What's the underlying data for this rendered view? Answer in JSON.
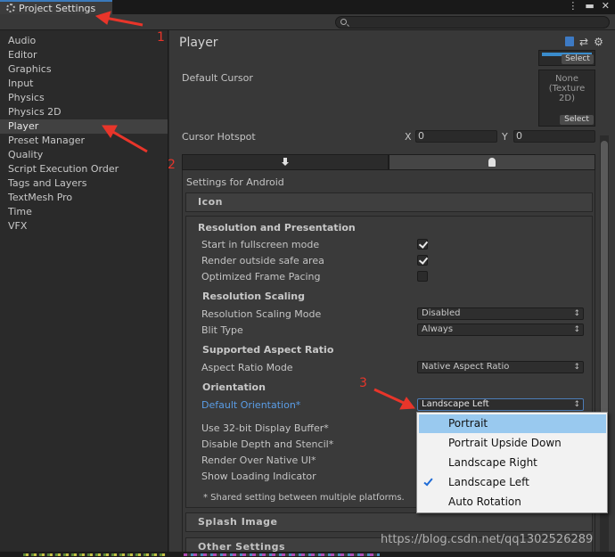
{
  "window": {
    "title": "Project Settings"
  },
  "sidebar": {
    "items": [
      {
        "label": "Audio"
      },
      {
        "label": "Editor"
      },
      {
        "label": "Graphics"
      },
      {
        "label": "Input"
      },
      {
        "label": "Physics"
      },
      {
        "label": "Physics 2D"
      },
      {
        "label": "Player"
      },
      {
        "label": "Preset Manager"
      },
      {
        "label": "Quality"
      },
      {
        "label": "Script Execution Order"
      },
      {
        "label": "Tags and Layers"
      },
      {
        "label": "TextMesh Pro"
      },
      {
        "label": "Time"
      },
      {
        "label": "VFX"
      }
    ],
    "selected": "Player"
  },
  "main": {
    "title": "Player",
    "default_cursor": {
      "label": "Default Cursor",
      "value_line1": "None",
      "value_line2": "(Texture",
      "value_line3": "2D)",
      "select": "Select"
    },
    "top_select": "Select",
    "cursor_hotspot": {
      "label": "Cursor Hotspot",
      "x_label": "X",
      "x": "0",
      "y_label": "Y",
      "y": "0"
    },
    "settings_for": "Settings for Android",
    "sections": {
      "icon": "Icon",
      "resolution": "Resolution and Presentation",
      "splash": "Splash Image",
      "other": "Other Settings"
    },
    "resolution": {
      "start_fullscreen": {
        "label": "Start in fullscreen mode",
        "checked": true
      },
      "render_outside_safe": {
        "label": "Render outside safe area",
        "checked": true
      },
      "optimized_frame_pacing": {
        "label": "Optimized Frame Pacing",
        "checked": false
      },
      "scaling_header": "Resolution Scaling",
      "scaling_mode": {
        "label": "Resolution Scaling Mode",
        "value": "Disabled"
      },
      "blit_type": {
        "label": "Blit Type",
        "value": "Always"
      },
      "aspect_header": "Supported Aspect Ratio",
      "aspect_mode": {
        "label": "Aspect Ratio Mode",
        "value": "Native Aspect Ratio"
      },
      "orientation_header": "Orientation",
      "default_orientation": {
        "label": "Default Orientation*",
        "value": "Landscape Left"
      },
      "use_32bit": "Use 32-bit Display Buffer*",
      "disable_depth": "Disable Depth and Stencil*",
      "render_native_ui": "Render Over Native UI*",
      "show_loading": "Show Loading Indicator",
      "footnote": "* Shared setting between multiple platforms."
    }
  },
  "orientation_popup": {
    "options": [
      "Portrait",
      "Portrait Upside Down",
      "Landscape Right",
      "Landscape Left",
      "Auto Rotation"
    ],
    "highlighted": "Portrait",
    "checked": "Landscape Left"
  },
  "annotations": {
    "one": "1",
    "two": "2",
    "three": "3"
  },
  "watermark": "https://blog.csdn.net/qq1302526289",
  "colors": {
    "accent": "#3a79bb",
    "highlight": "#99c9ef",
    "annotation": "#e8352a",
    "label_blue": "#5a9de6"
  }
}
